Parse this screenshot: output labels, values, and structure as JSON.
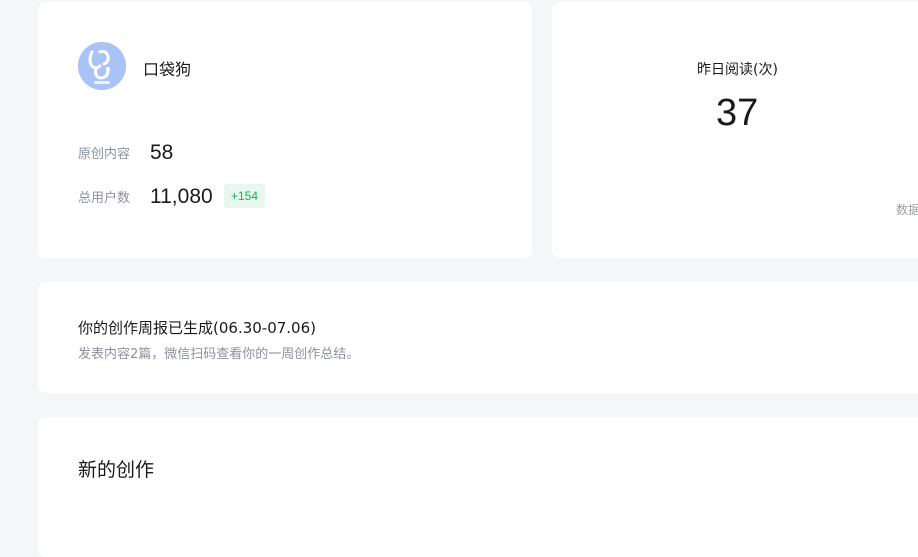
{
  "account": {
    "avatar_icon": "dog-logo-icon",
    "avatar_color": "#a9c3f7",
    "name": "口袋狗",
    "original_label": "原创内容",
    "original_value": "58",
    "users_label": "总用户数",
    "users_value": "11,080",
    "users_delta": "+154"
  },
  "reads": {
    "label": "昨日阅读(次)",
    "value": "37",
    "note": "数据"
  },
  "weekly_report": {
    "title": "你的创作周报已生成(06.30-07.06)",
    "subtitle": "发表内容2篇，微信扫码查看你的一周创作总结。"
  },
  "new_creation": {
    "title": "新的创作"
  },
  "colors": {
    "background": "#f5f6f7",
    "card": "#ffffff",
    "delta_text": "#1aaf57",
    "delta_bg": "#e8f8ee"
  }
}
